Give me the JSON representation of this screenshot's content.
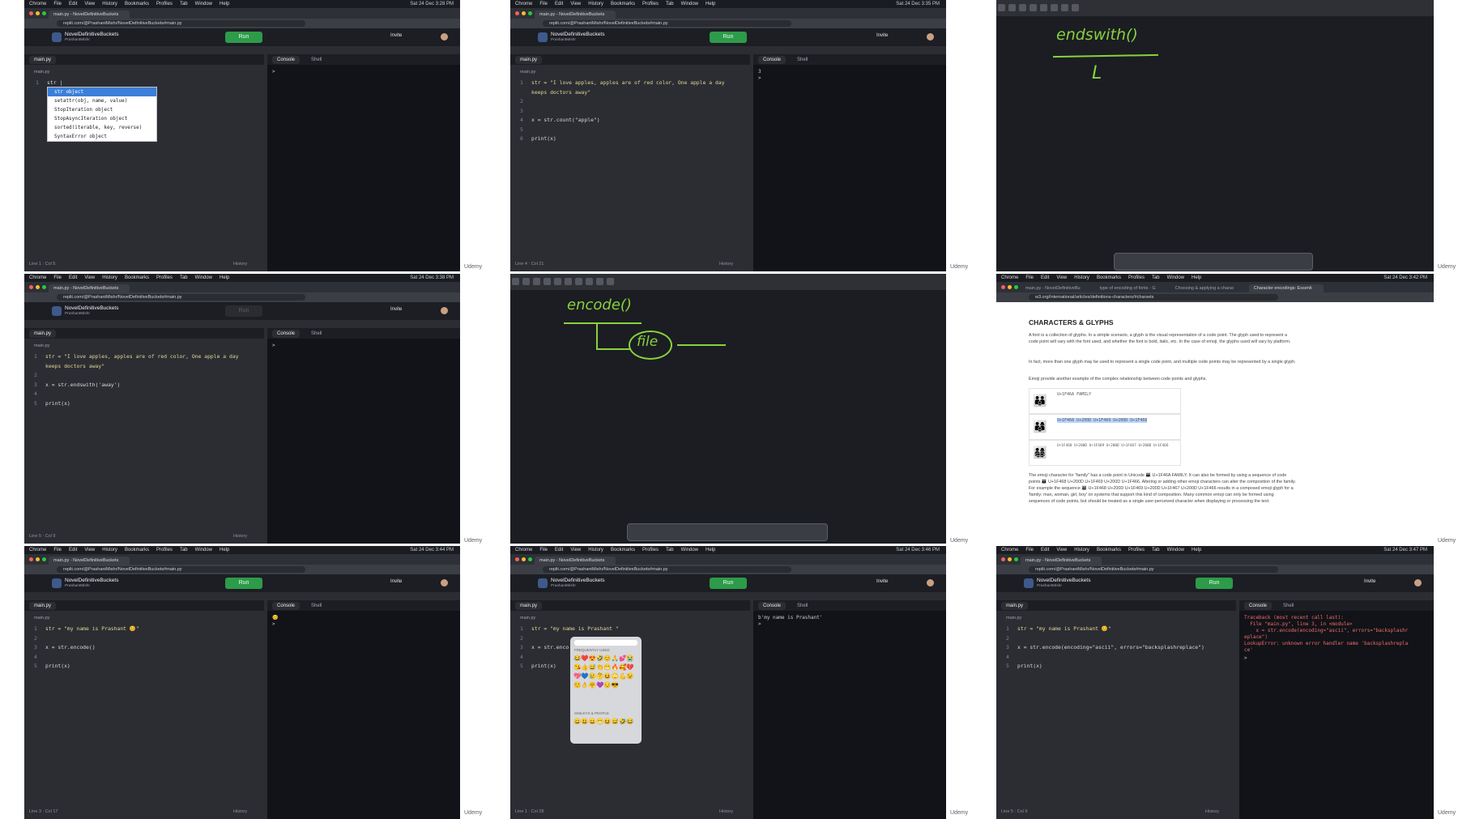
{
  "brand": "Udemy",
  "mac_menu": [
    "Chrome",
    "File",
    "Edit",
    "View",
    "History",
    "Bookmarks",
    "Profiles",
    "Tab",
    "Window",
    "Help"
  ],
  "common": {
    "chrome_tab": "main.py - NovelDefinitiveBuckets",
    "url": "replit.com/@PrashantMishr/NovelDefinitiveBuckets#main.py",
    "project_title": "NovelDefinitiveBuckets",
    "project_owner": "PrashantMishr",
    "run_label": "Run",
    "invite_label": "Invite",
    "file_tab": "main.py",
    "breadcrumb": "main.py",
    "console_tab": "Console",
    "shell_tab": "Shell",
    "history_label": "History"
  },
  "tiles": {
    "t1": {
      "clock": "Sat 24 Dec 3:28 PM",
      "code": [
        "str |"
      ],
      "autocomplete": [
        "str object",
        "setattr(obj, name, value)",
        "StopIteration object",
        "StopAsyncIteration object",
        "sorted(iterable, key, reverse)",
        "SyntaxError object"
      ],
      "status": "Line 1 : Col 5",
      "console": ">"
    },
    "t2": {
      "clock": "Sat 24 Dec 3:35 PM",
      "code": [
        "str = \"I love apples, apples are of red color, One apple a day",
        "keeps doctors away\"",
        "",
        "",
        "x = str.count(\"apple\")",
        "",
        "print(x)"
      ],
      "lines": [
        "1",
        "",
        "2",
        "3",
        "4",
        "5",
        "6"
      ],
      "status": "Line 4 : Col 21",
      "console": "3\n> "
    },
    "t3": {
      "text1": "endswith()",
      "text2": "L"
    },
    "t4": {
      "clock": "Sat 24 Dec 3:38 PM",
      "code": [
        "str = \"I love apples, apples are of red color, One apple a day",
        "keeps doctors away\"",
        "",
        "x = str.endswith('away')",
        "",
        "print(x)"
      ],
      "lines": [
        "1",
        "",
        "2",
        "3",
        "4",
        "5"
      ],
      "status": "Line 5 : Col 9",
      "console": "> "
    },
    "t5": {
      "text1": "encode()",
      "text2": "file"
    },
    "t6": {
      "clock": "Sat 24 Dec 3:42 PM",
      "tabs": [
        "main.py - NovelDefinitiveBu",
        "type of encoding of fonts - G",
        "Choosing & applying a charac",
        "Character encodings: Essenti"
      ],
      "url": "w3.org/International/articles/definitions-characters/#charsets",
      "heading": "CHARACTERS & GLYPHS",
      "p1": "A font is a collection of glyphs. In a simple scenario, a glyph is the visual representation of a code point. The glyph used to represent a code point will vary with the font used, and whether the font is bold, italic, etc. In the case of emoji, the glyphs used will vary by platform.",
      "p2": "In fact, more than one glyph may be used to represent a single code point, and multiple code points may be represented by a single glyph.",
      "p3": "Emoji provide another example of the complex relationship between code points and glyphs.",
      "rows": [
        "U+1F46A FAMILY",
        "U+1F468 U+200D U+1F469 U+200D U+1F466",
        "U+1F468 U+200D U+1F469 U+200D U+1F467 U+200D U+1F466"
      ],
      "emoji_rows": [
        "👪",
        "👨‍👩‍👦",
        "👨‍👩‍👧‍👦"
      ],
      "p4": "The emoji character for \"family\" has a code point in Unicode 👪 U+1F46A FAMILY. It can also be formed by using a sequence of code points 👨‍👩‍👦 U+1F468 U+200D U+1F469 U+200D U+1F466. Altering or adding other emoji characters can alter the composition of the family. For example the sequence 👨‍👩‍👧‍👦 U+1F468 U+200D U+1F469 U+200D U+1F467 U+200D U+1F466 results in a composed emoji glyph for a 'family: man, woman, girl, boy' on systems that support this kind of composition. Many common emoji can only be formed using sequences of code points, but should be treated as a single user-perceived character when displaying or processing the text."
    },
    "t7": {
      "clock": "Sat 24 Dec 3:44 PM",
      "code": [
        "str = \"my name is Prashant 😊\"",
        "",
        "x = str.encode()",
        "",
        "print(x)"
      ],
      "lines": [
        "1",
        "2",
        "3",
        "4",
        "5"
      ],
      "status": "Line 3 : Col 17",
      "console": "😊\n> "
    },
    "t8": {
      "clock": "Sat 24 Dec 3:46 PM",
      "code": [
        "str = \"my name is Prashant \"",
        "",
        "x = str.enco",
        "",
        "print(x)"
      ],
      "lines": [
        "1",
        "2",
        "3",
        "4",
        "5"
      ],
      "status": "Line 1 : Col 28",
      "console": "b'my name is Prashant'\n> ",
      "picker_heading": "FREQUENTLY USED",
      "picker_heading2": "SMILEYS & PEOPLE",
      "picker_emojis": "😂❤️😍🤣😊🙏💕😭😘👍😅👏😁🔥🥰💔💖💙😢🤔😆🙄💪😉☺️👌🤗💜😔😎",
      "picker_emojis2": "😀😃😄😁😆😅🤣😂"
    },
    "t9": {
      "clock": "Sat 24 Dec 3:47 PM",
      "code": [
        "str = \"my name is Prashant 😊\"",
        "",
        "x = str.encode(encoding=\"ascii\", errors=\"backsplashreplace\")",
        "",
        "print(x)"
      ],
      "lines": [
        "1",
        "2",
        "3",
        "4",
        "5"
      ],
      "status": "Line 5 : Col 9",
      "error": [
        "Traceback (most recent call last):",
        "  File \"main.py\", line 3, in <module>",
        "    x = str.encode(encoding=\"ascii\", errors=\"backsplashr",
        "eplace\")",
        "LookupError: unknown error handler name 'backsplashrepla",
        "ce'"
      ],
      "console": "> "
    }
  }
}
